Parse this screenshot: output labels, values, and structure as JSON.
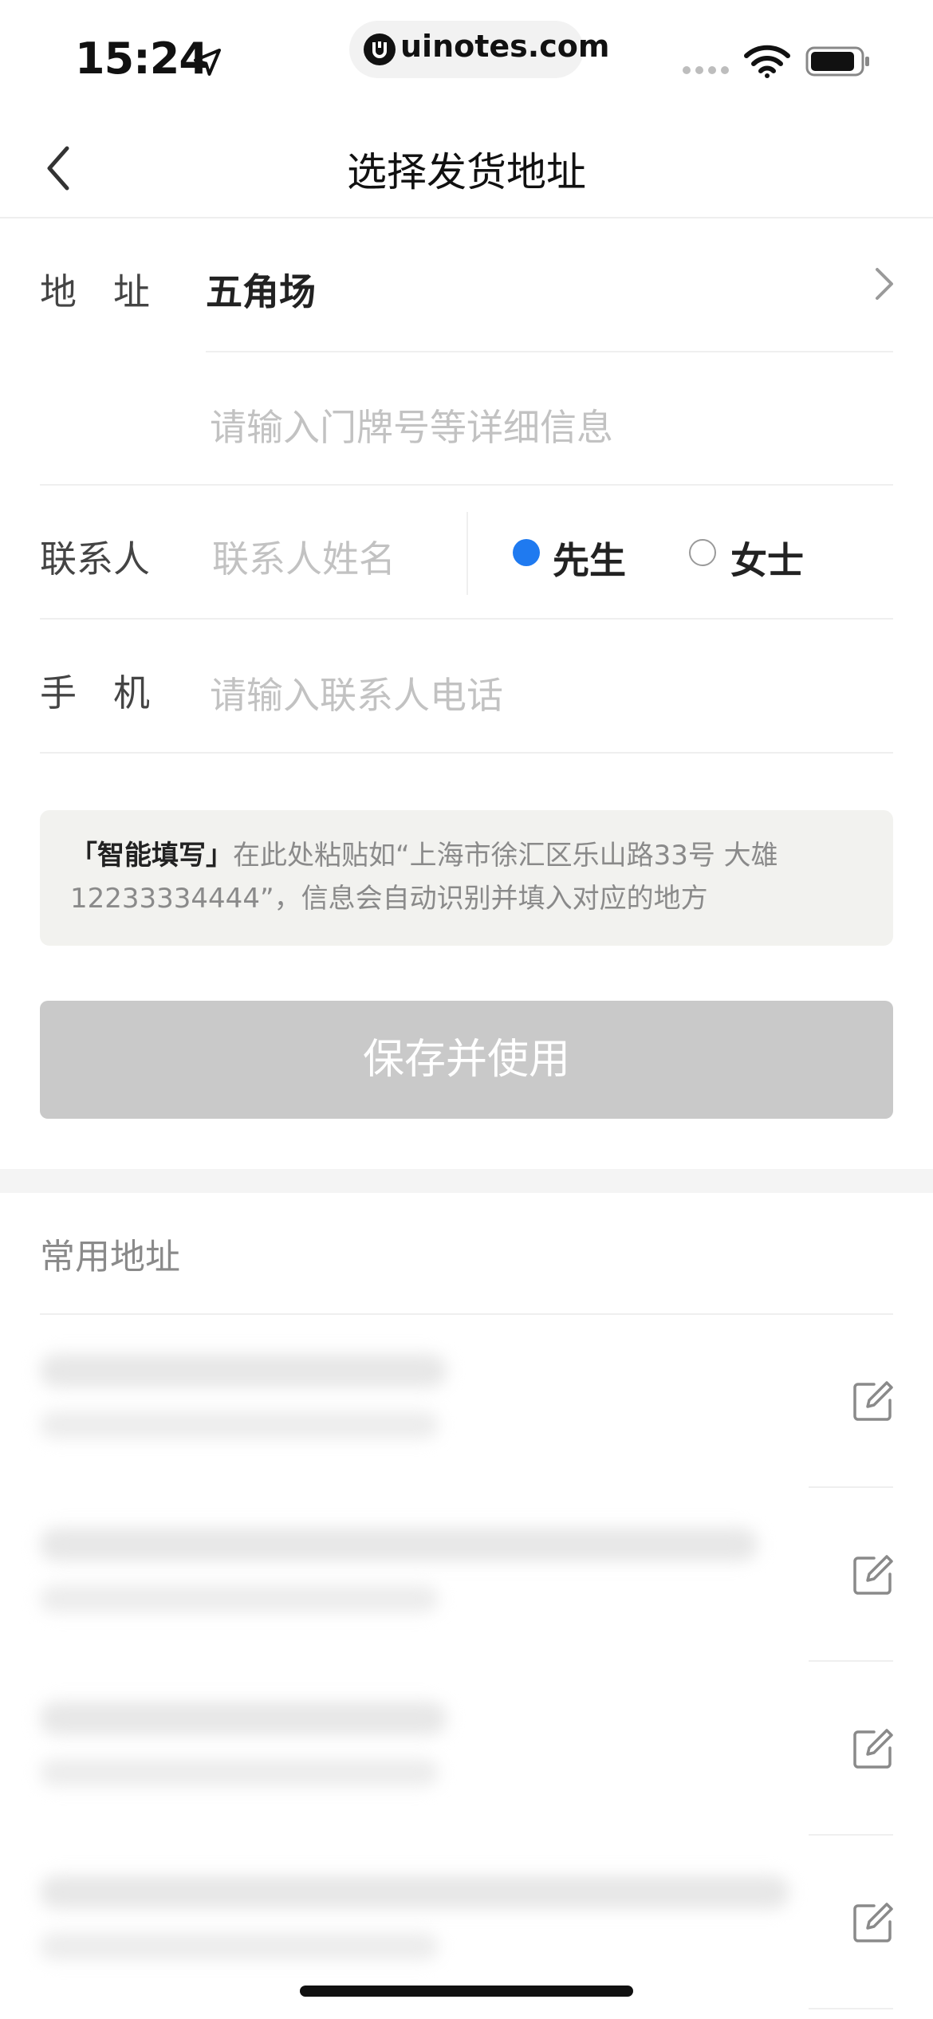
{
  "status_bar": {
    "time": "15:24",
    "url": "uinotes.com"
  },
  "nav": {
    "title": "选择发货地址"
  },
  "form": {
    "address_label": "地　址",
    "address_value": "五角场",
    "detail_placeholder": "请输入门牌号等详细信息",
    "contact_label": "联系人",
    "contact_placeholder": "联系人姓名",
    "gender_options": [
      {
        "label": "先生",
        "selected": true
      },
      {
        "label": "女士",
        "selected": false
      }
    ],
    "phone_label": "手　机",
    "phone_placeholder": "请输入联系人电话"
  },
  "smart_fill": {
    "title": "「智能填写」",
    "text": "在此处粘贴如“上海市徐汇区乐山路33号 大雄 12233334444”，信息会自动识别并填入对应的地方"
  },
  "save_button": {
    "label": "保存并使用",
    "enabled": false
  },
  "common": {
    "title": "常用地址",
    "items_visible": 4,
    "content_obscured": true
  },
  "colors": {
    "accent": "#1f7af0",
    "disabled_button": "#c9c9c9",
    "placeholder": "#c2c2c2",
    "smart_box_bg": "#f2f2ef"
  },
  "icons": [
    "location-arrow-icon",
    "wifi-icon",
    "battery-icon",
    "back-chevron-icon",
    "chevron-right-icon",
    "edit-icon"
  ]
}
